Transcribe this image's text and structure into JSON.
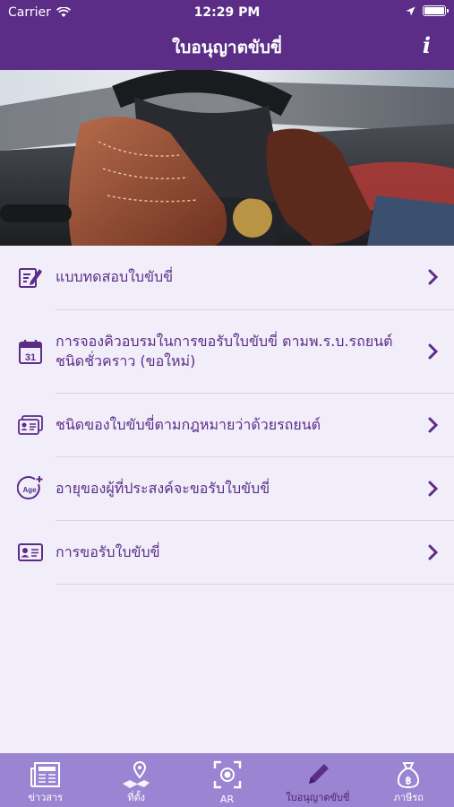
{
  "status_bar": {
    "carrier": "Carrier",
    "time": "12:29 PM"
  },
  "header": {
    "title": "ใบอนุญาตขับขี่",
    "info_icon": "info-icon"
  },
  "hero": {
    "subject": "driver-gloves-steering-wheel-photo"
  },
  "menu": {
    "items": [
      {
        "label": "แบบทดสอบใบขับขี่",
        "icon": "edit-form-icon"
      },
      {
        "label": "การจองคิวอบรมในการขอรับใบขับขี่ ตามพ.ร.บ.รถยนต์ ชนิดชั่วคราว (ขอใหม่)",
        "icon": "calendar-icon",
        "date": "31"
      },
      {
        "label": "ชนิดของใบขับขี่ตามกฎหมายว่าด้วยรถยนต์",
        "icon": "license-cards-icon"
      },
      {
        "label": "อายุของผู้ที่ประสงค์จะขอรับใบขับขี่",
        "icon": "age-plus-icon",
        "badge": "Age"
      },
      {
        "label": "การขอรับใบขับขี่",
        "icon": "license-card-icon"
      }
    ]
  },
  "tabbar": {
    "tabs": [
      {
        "label": "ข่าวสาร",
        "icon": "newspaper-icon"
      },
      {
        "label": "ที่ตั้ง",
        "icon": "map-pin-icon"
      },
      {
        "label": "AR",
        "icon": "ar-scan-icon"
      },
      {
        "label": "ใบอนุญาตขับขี่",
        "icon": "pencil-icon",
        "active": true
      },
      {
        "label": "ภาษีรถ",
        "icon": "money-bag-icon"
      }
    ]
  },
  "colors": {
    "header": "#5b2d87",
    "tabbar": "#9b84d1",
    "accent": "#5b2d87",
    "background": "#f1eefa"
  }
}
